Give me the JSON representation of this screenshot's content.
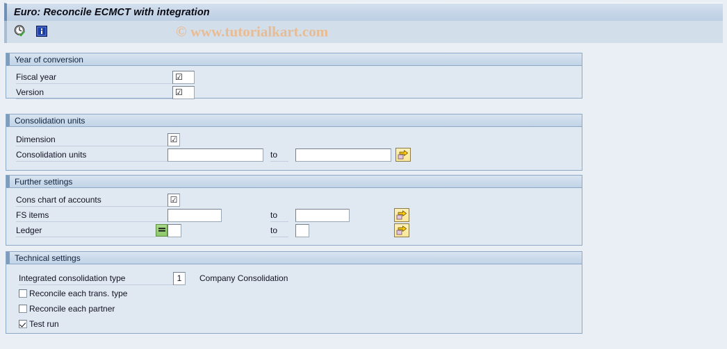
{
  "window": {
    "title": "Euro: Reconcile ECMCT with integration"
  },
  "toolbar": {
    "execute_icon": "clock-check-execute-icon",
    "info_icon": "information-icon",
    "watermark": "© www.tutorialkart.com"
  },
  "sections": [
    {
      "header": "Year of conversion",
      "fields": [
        {
          "label": "Fiscal year",
          "value": "",
          "glyph": "☑"
        },
        {
          "label": "Version",
          "value": "",
          "glyph": "☑"
        }
      ]
    },
    {
      "header": "Consolidation units",
      "fields": [
        {
          "label": "Dimension",
          "value": "",
          "glyph": "☑"
        },
        {
          "label": "Consolidation units",
          "value": "",
          "to_label": "to",
          "value_to": ""
        }
      ]
    },
    {
      "header": "Further settings",
      "fields": [
        {
          "label": "Cons chart of accounts",
          "value": "",
          "glyph": "☑"
        },
        {
          "label": "FS items",
          "value": "",
          "to_label": "to",
          "value_to": ""
        },
        {
          "label": "Ledger",
          "value": "",
          "to_label": "to",
          "value_to": "",
          "op_icon": "equals-selection-option-icon"
        }
      ]
    },
    {
      "header": "Technical settings",
      "fields": [
        {
          "label": "Integrated consolidation type",
          "value": "1",
          "description": "Company Consolidation"
        }
      ],
      "checkboxes": [
        {
          "label": "Reconcile each trans. type",
          "checked": false
        },
        {
          "label": "Reconcile each partner",
          "checked": false
        },
        {
          "label": "Test run",
          "checked": true
        }
      ]
    }
  ],
  "colors": {
    "page_background": "#eaeef5",
    "panel_background": "#e0e8f1",
    "panel_border": "#8ba8c6",
    "title_accent": "#6f8fb5",
    "watermark": "#e8bc92",
    "multi_select_button": "#fbe79a",
    "equals_button": "#8cc96a"
  }
}
